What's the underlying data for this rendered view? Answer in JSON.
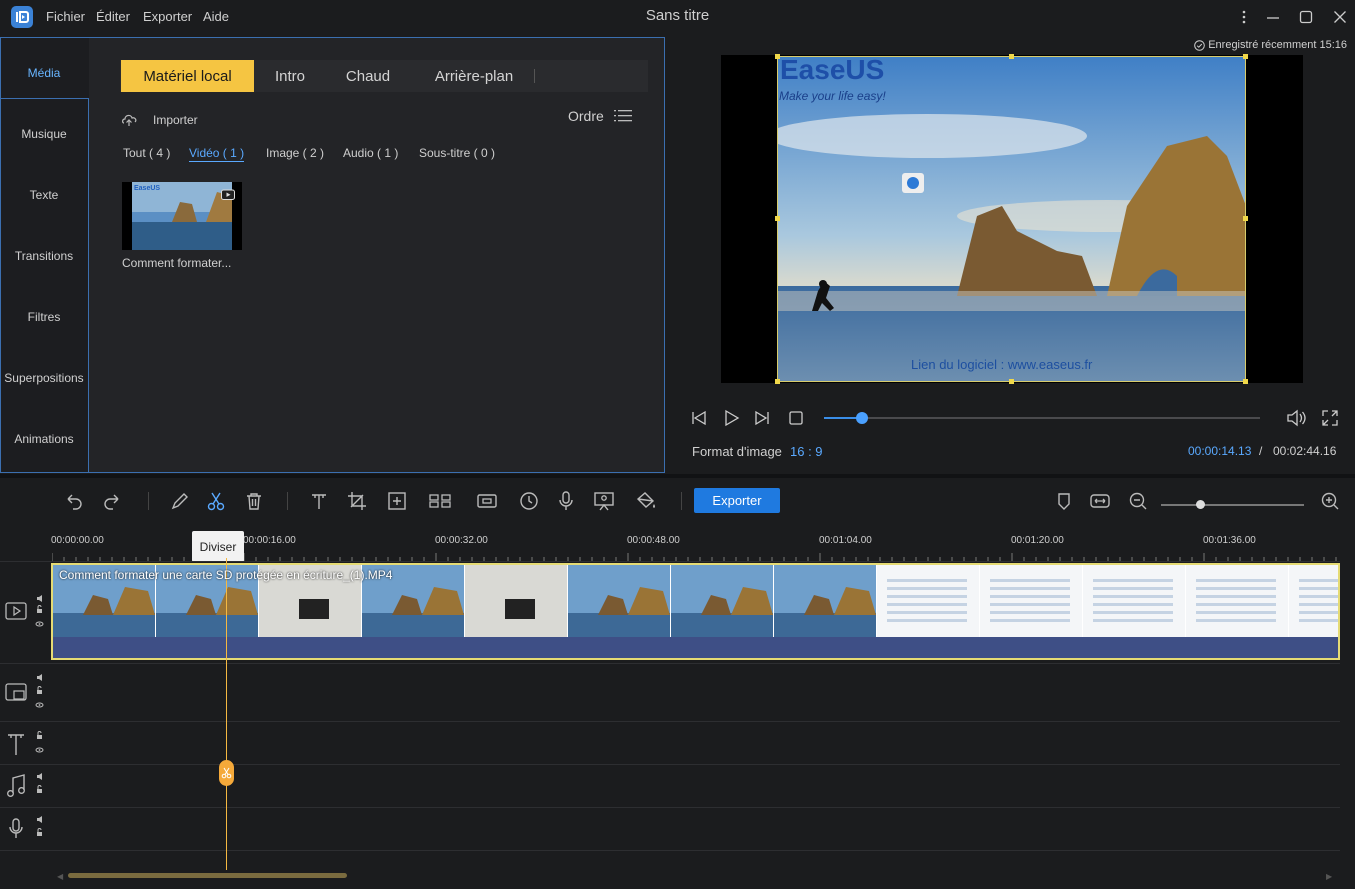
{
  "titlebar": {
    "menu": [
      "Fichier",
      "Éditer",
      "Exporter",
      "Aide"
    ],
    "title": "Sans titre"
  },
  "sidebar": {
    "items": [
      {
        "label": "Média",
        "active": true
      },
      {
        "label": "Musique"
      },
      {
        "label": "Texte"
      },
      {
        "label": "Transitions"
      },
      {
        "label": "Filtres"
      },
      {
        "label": "Superpositions"
      },
      {
        "label": "Animations"
      }
    ]
  },
  "library": {
    "tabs": [
      {
        "label": "Matériel local",
        "active": true
      },
      {
        "label": "Intro"
      },
      {
        "label": "Chaud"
      },
      {
        "label": "Arrière-plan"
      }
    ],
    "import_label": "Importer",
    "order_label": "Ordre",
    "filters": [
      {
        "label": "Tout ( 4 )"
      },
      {
        "label": "Vidéo ( 1 )",
        "active": true
      },
      {
        "label": "Image ( 2 )"
      },
      {
        "label": "Audio ( 1 )"
      },
      {
        "label": "Sous-titre ( 0 )"
      }
    ],
    "media_item": {
      "name": "Comment formater..."
    }
  },
  "preview": {
    "autosave": "Enregistré récemment 15:16",
    "brand": "EaseUS",
    "tagline": "Make your life easy!",
    "overlay_text": "Lien du logiciel : www.easeus.fr",
    "aspect_label": "Format d'image",
    "aspect_value": "16 : 9",
    "time_current": "00:00:14.13",
    "time_sep": "/",
    "time_total": "00:02:44.16",
    "progress": 0.087
  },
  "toolbar": {
    "export_label": "Exporter",
    "tooltip": "Diviser",
    "zoom": 0.27
  },
  "timeline": {
    "ruler": [
      "00:00:00.00",
      "00:00:16.00",
      "00:00:32.00",
      "00:00:48.00",
      "00:01:04.00",
      "00:01:20.00",
      "00:01:36.00"
    ],
    "clip_name": "Comment formater une carte SD protégée en écriture_(1).MP4",
    "colors": {
      "accent": "#f5c542",
      "playhead": "#f5b942",
      "selection": "#e5db74",
      "blue": "#1f7ae0"
    }
  }
}
